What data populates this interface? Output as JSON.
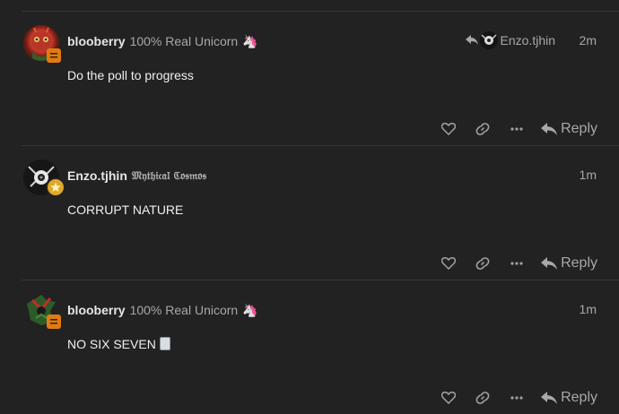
{
  "posts": [
    {
      "username": "blooberry",
      "title": "100% Real Unicorn",
      "title_emoji": "🦄",
      "reply_to": "Enzo.tjhin",
      "age": "2m",
      "body": "Do the poll to progress",
      "reply_label": "Reply"
    },
    {
      "username": "Enzo.tjhin",
      "title": "𝔐𝔶𝔱𝔥𝔦𝔠𝔞𝔩 ℭ𝔬𝔰𝔪𝔬𝔰",
      "age": "1m",
      "body": "CORRUPT NATURE",
      "reply_label": "Reply"
    },
    {
      "username": "blooberry",
      "title": "100% Real Unicorn",
      "title_emoji": "🦄",
      "age": "1m",
      "body": "NO SIX SEVEN",
      "reply_label": "Reply"
    }
  ],
  "colors": {
    "background": "#222222",
    "text_primary": "#dddddd",
    "text_muted": "#a8a8a8",
    "flair_gold": "#e0a92a",
    "flair_orange": "#e07b12"
  }
}
